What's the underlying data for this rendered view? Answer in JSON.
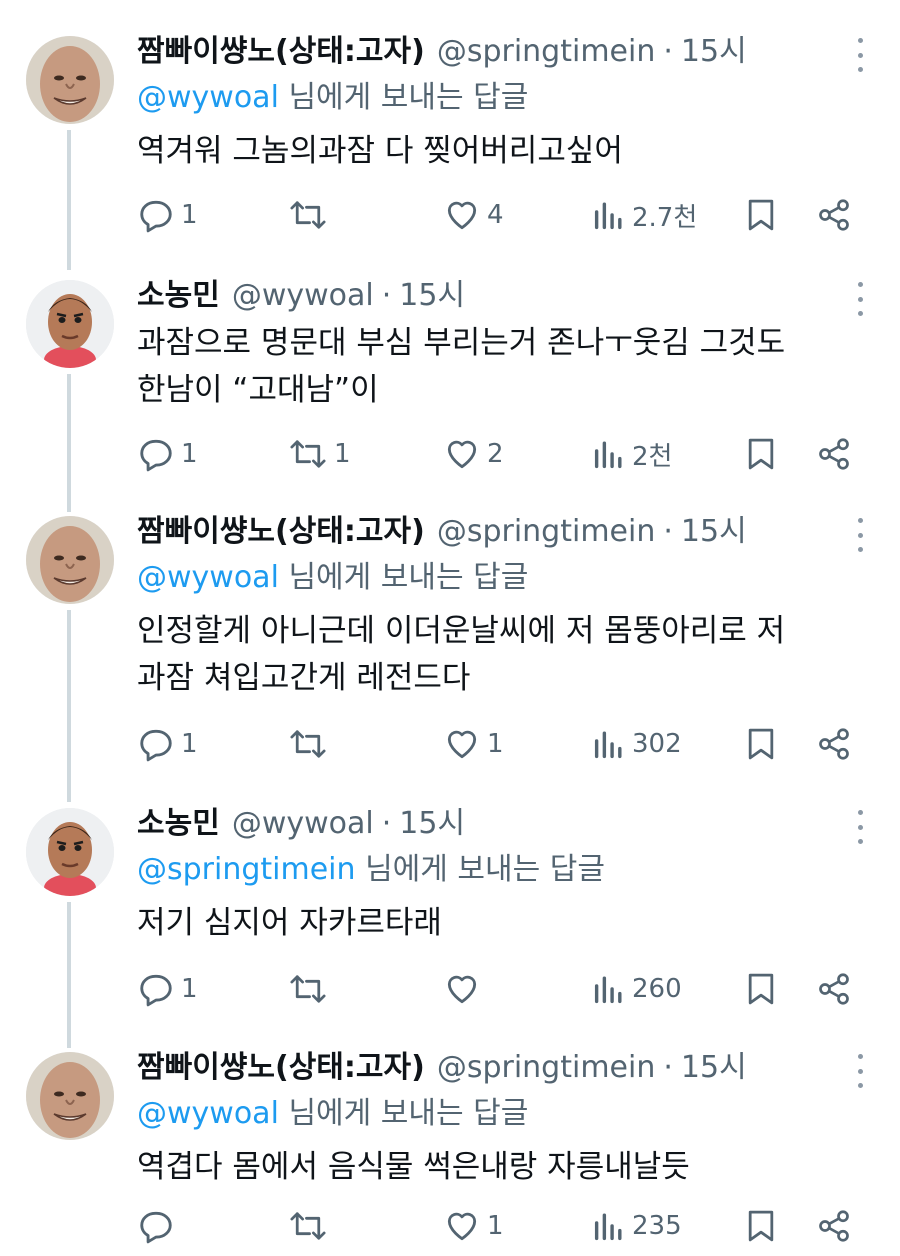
{
  "colors": {
    "mention": "#1d9bf0",
    "secondary": "#536471",
    "thread_line": "#cfd9de"
  },
  "tweets": [
    {
      "name": "짬빠이썅노(상태:고자)",
      "handle": "@springtimein",
      "separator": "·",
      "time": "15시",
      "reply_mention": "@wywoal",
      "reply_suffix": " 님에게 보내는 답글",
      "text": "역겨워 그놈의과잠 다 찢어버리고싶어",
      "replies": "1",
      "retweets": "",
      "likes": "4",
      "views": "2.7천"
    },
    {
      "name": "소농민",
      "handle": "@wywoal",
      "separator": "·",
      "time": "15시",
      "reply_mention": "",
      "reply_suffix": "",
      "text": "과잠으로 명문대 부심 부리는거 존나ㅜ웃김 그것도\n한남이 “고대남”이",
      "replies": "1",
      "retweets": "1",
      "likes": "2",
      "views": "2천"
    },
    {
      "name": "짬빠이썅노(상태:고자)",
      "handle": "@springtimein",
      "separator": "·",
      "time": "15시",
      "reply_mention": "@wywoal",
      "reply_suffix": " 님에게 보내는 답글",
      "text": "인정할게 아니근데 이더운날씨에 저 몸뚱아리로 저\n과잠 쳐입고간게 레전드다",
      "replies": "1",
      "retweets": "",
      "likes": "1",
      "views": "302"
    },
    {
      "name": "소농민",
      "handle": "@wywoal",
      "separator": "·",
      "time": "15시",
      "reply_mention": "@springtimein",
      "reply_suffix": " 님에게 보내는 답글",
      "text": "저기 심지어 자카르타래",
      "replies": "1",
      "retweets": "",
      "likes": "",
      "views": "260"
    },
    {
      "name": "짬빠이썅노(상태:고자)",
      "handle": "@springtimein",
      "separator": "·",
      "time": "15시",
      "reply_mention": "@wywoal",
      "reply_suffix": " 님에게 보내는 답글",
      "text": "역겹다 몸에서 음식물 썩은내랑 자릉내날듯",
      "replies": "",
      "retweets": "",
      "likes": "1",
      "views": "235"
    }
  ]
}
